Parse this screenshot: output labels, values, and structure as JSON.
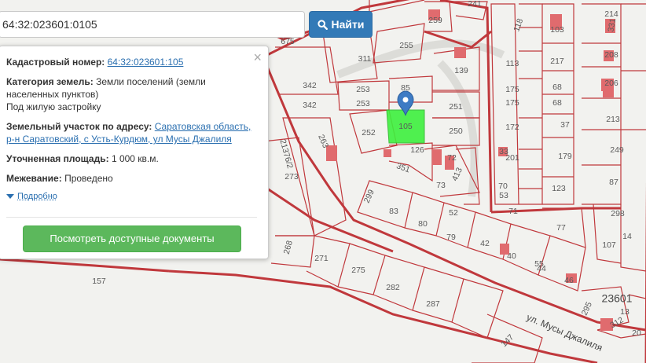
{
  "search": {
    "value": "64:32:023601:0105",
    "button_label": "Найти"
  },
  "popup": {
    "cadastral_label": "Кадастровый номер:",
    "cadastral_value": "64:32:023601:105",
    "category_label": "Категория земель:",
    "category_value_1": "Земли поселений (земли",
    "category_value_2": "населенных пунктов)",
    "usage_value": "Под жилую застройку",
    "address_label": "Земельный участок по адресу:",
    "address_value_1": "Саратовская область,",
    "address_value_2": "р-н Саратовский, с Усть-Курдюм, ул Мусы Джалиля",
    "area_label": "Уточненная площадь:",
    "area_value": "1 000 кв.м.",
    "survey_label": "Межевание:",
    "survey_value": "Проведено",
    "more_link": "Подробно",
    "docs_button": "Посмотреть доступные документы",
    "close_symbol": "×"
  },
  "map": {
    "street_label": "ул. Мусы Джалиля",
    "quarter_label": "23601",
    "highlight_color": "#3ef03e",
    "border_color": "#c0383c",
    "building_color": "#e06b6e",
    "plots": [
      "241",
      "259",
      "118",
      "103",
      "214",
      "331",
      "675",
      "255",
      "311",
      "217",
      "208",
      "139",
      "113",
      "342",
      "85",
      "253",
      "253",
      "342",
      "175",
      "175",
      "68",
      "68",
      "206",
      "251",
      "105",
      "250",
      "172",
      "37",
      "213",
      "252",
      "263",
      "126",
      "21376/2",
      "33",
      "201",
      "179",
      "249",
      "351",
      "72",
      "413",
      "273",
      "87",
      "73",
      "70",
      "123",
      "53",
      "71",
      "299",
      "83",
      "80",
      "79",
      "52",
      "298",
      "268",
      "77",
      "42",
      "40",
      "14",
      "271",
      "275",
      "44",
      "55",
      "107",
      "46",
      "157",
      "282",
      "287",
      "295",
      "13",
      "312",
      "147",
      "20"
    ]
  }
}
